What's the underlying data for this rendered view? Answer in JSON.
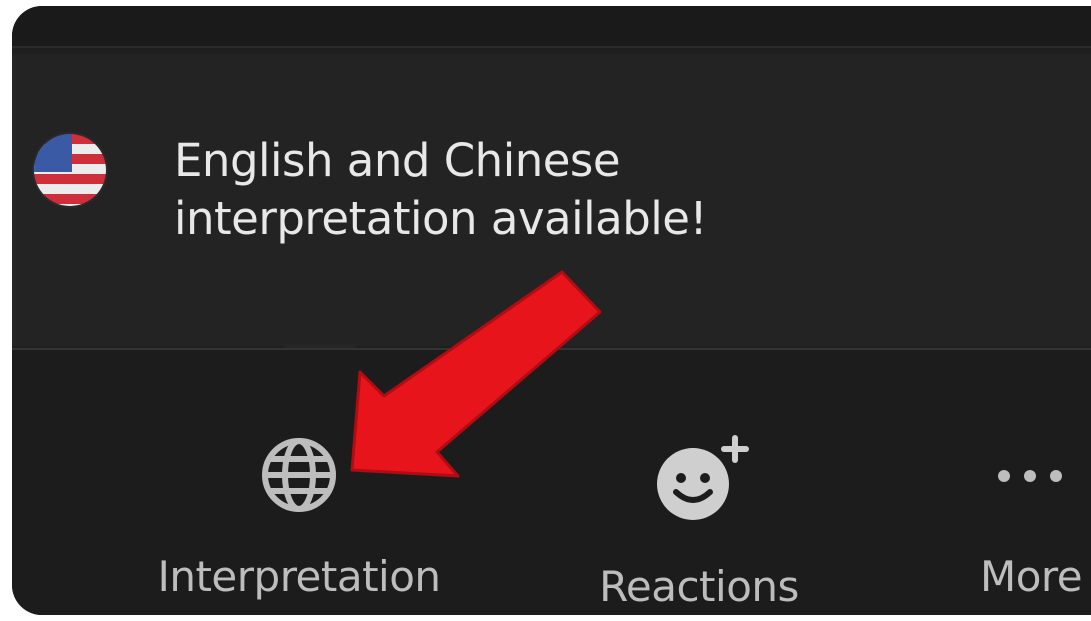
{
  "tooltip": {
    "line1": "English and Chinese",
    "line2": "interpretation available!",
    "flag_icon": "us-flag-icon"
  },
  "toolbar": {
    "interpretation": {
      "label": "Interpretation",
      "icon": "globe-icon"
    },
    "reactions": {
      "label": "Reactions",
      "icon": "smiley-plus-icon"
    },
    "more": {
      "label": "More",
      "icon": "ellipsis-icon"
    }
  },
  "annotation": {
    "icon": "red-arrow",
    "color": "#e8141c"
  }
}
